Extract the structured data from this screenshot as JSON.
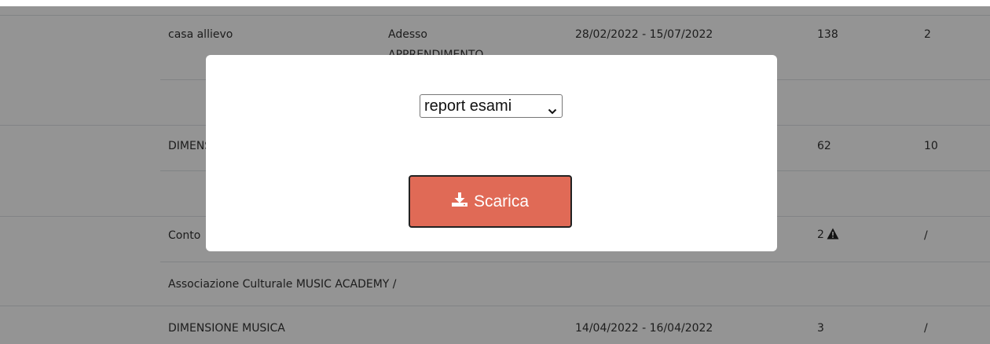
{
  "table": {
    "rows": [
      {
        "col1": "casa allievo",
        "col2": "Adesso",
        "col2_overflow": "APPRENDIMENTO",
        "col3": "28/02/2022 - 15/07/2022",
        "col4": "138",
        "col5": "2"
      },
      {
        "col1": "DIMENSIONE MUSICA",
        "col4": "62",
        "col5": "10"
      },
      {
        "col1": "Conto",
        "col4": "2",
        "col5": "/",
        "warning_icon": "warning-triangle-icon"
      },
      {
        "col1": "Associazione Culturale MUSIC ACADEMY /"
      },
      {
        "col1": "DIMENSIONE MUSICA",
        "col3": "14/04/2022 - 16/04/2022",
        "col4": "3",
        "col5": "/"
      }
    ]
  },
  "modal": {
    "select": {
      "value": "report esami",
      "icon": "chevron-down-icon"
    },
    "button": {
      "label": "Scarica",
      "icon": "download-icon",
      "color": "#e06a56"
    }
  }
}
